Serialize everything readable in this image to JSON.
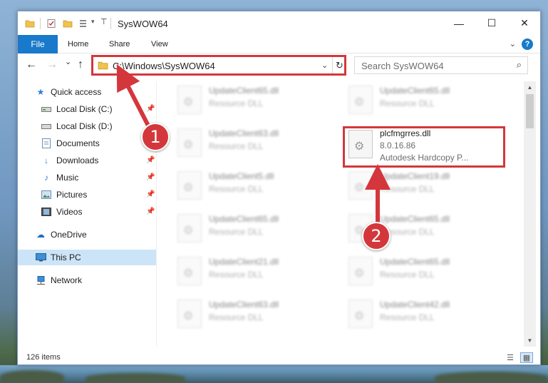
{
  "window": {
    "title": "SysWOW64",
    "controls": {
      "minimize": "—",
      "maximize": "☐",
      "close": "✕"
    }
  },
  "ribbon": {
    "file_tab": "File",
    "tabs": [
      "Home",
      "Share",
      "View"
    ],
    "expand_glyph": "⌄",
    "help_glyph": "?"
  },
  "navigation": {
    "back_glyph": "←",
    "forward_glyph": "→",
    "recent_glyph": "⌄",
    "up_glyph": "↑",
    "address": "C:\\Windows\\SysWOW64",
    "address_chevron": "⌄",
    "refresh_glyph": "↻",
    "search_placeholder": "Search SysWOW64",
    "search_glyph": "⌕"
  },
  "sidebar": {
    "items": [
      {
        "label": "Quick access",
        "icon": "star-icon",
        "pinned": false
      },
      {
        "label": "Local Disk (C:)",
        "icon": "drive-icon",
        "pinned": true
      },
      {
        "label": "Local Disk (D:)",
        "icon": "drive-icon",
        "pinned": false
      },
      {
        "label": "Documents",
        "icon": "documents-icon",
        "pinned": true
      },
      {
        "label": "Downloads",
        "icon": "download-icon",
        "pinned": true
      },
      {
        "label": "Music",
        "icon": "music-icon",
        "pinned": true
      },
      {
        "label": "Pictures",
        "icon": "pictures-icon",
        "pinned": true
      },
      {
        "label": "Videos",
        "icon": "videos-icon",
        "pinned": true
      },
      {
        "label": "OneDrive",
        "icon": "cloud-icon",
        "pinned": false
      },
      {
        "label": "This PC",
        "icon": "computer-icon",
        "pinned": false,
        "selected": true
      },
      {
        "label": "Network",
        "icon": "network-icon",
        "pinned": false
      }
    ]
  },
  "files": [
    {
      "name": "UpdateClient65.dll",
      "line2": "Resource DLL",
      "blurred": true
    },
    {
      "name": "UpdateClient65.dll",
      "line2": "Resource DLL",
      "blurred": true
    },
    {
      "name": "UpdateClient63.dll",
      "line2": "Resource DLL",
      "blurred": true
    },
    {
      "name": "plcfmgrres.dll",
      "line2": "8.0.16.86",
      "line3": "Autodesk Hardcopy P...",
      "blurred": false,
      "highlighted": true
    },
    {
      "name": "UpdateClient5.dll",
      "line2": "Resource DLL",
      "blurred": true
    },
    {
      "name": "UpdateClient19.dll",
      "line2": "Resource DLL",
      "blurred": true
    },
    {
      "name": "UpdateClient65.dll",
      "line2": "Resource DLL",
      "blurred": true
    },
    {
      "name": "UpdateClient65.dll",
      "line2": "Resource DLL",
      "blurred": true
    },
    {
      "name": "UpdateClient21.dll",
      "line2": "Resource DLL",
      "blurred": true
    },
    {
      "name": "UpdateClient65.dll",
      "line2": "Resource DLL",
      "blurred": true
    },
    {
      "name": "UpdateClient63.dll",
      "line2": "Resource DLL",
      "blurred": true
    },
    {
      "name": "UpdateClient42.dll",
      "line2": "Resource DLL",
      "blurred": true
    }
  ],
  "status": {
    "item_count": "126 items"
  },
  "annotations": {
    "step1": "1",
    "step2": "2",
    "color": "#d4373b"
  }
}
